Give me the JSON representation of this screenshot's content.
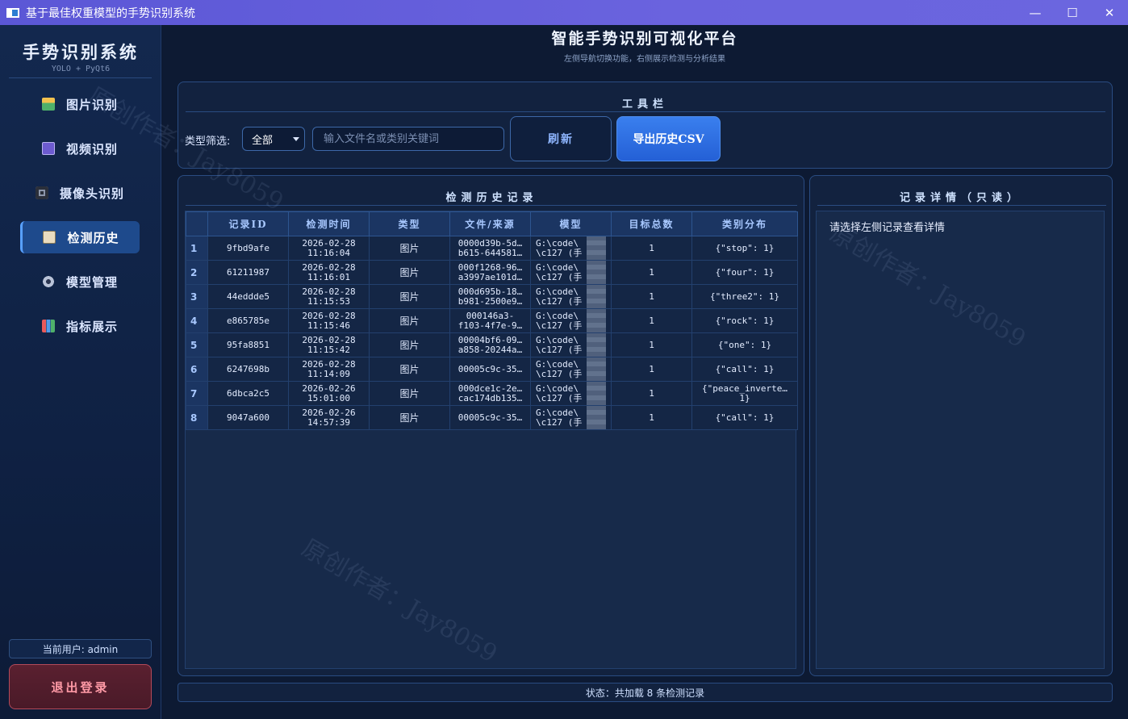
{
  "window": {
    "title": "基于最佳权重模型的手势识别系统",
    "min_icon": "minimize-icon",
    "max_icon": "maximize-icon",
    "close_icon": "close-icon"
  },
  "sidebar": {
    "brand": "手势识别系统",
    "brand_sub": "YOLO + PyQt6",
    "items": [
      {
        "label": "图片识别",
        "icon": "picture-icon",
        "active": false
      },
      {
        "label": "视频识别",
        "icon": "clapper-icon",
        "active": false
      },
      {
        "label": "摄像头识别",
        "icon": "camera-icon",
        "active": false
      },
      {
        "label": "检测历史",
        "icon": "notepad-icon",
        "active": true
      },
      {
        "label": "模型管理",
        "icon": "gear-icon",
        "active": false
      },
      {
        "label": "指标展示",
        "icon": "bar-chart-icon",
        "active": false
      }
    ],
    "current_user": "当前用户: admin",
    "logout": "退出登录"
  },
  "header": {
    "title": "智能手势识别可视化平台",
    "subtitle": "左侧导航切换功能，右侧展示检测与分析结果"
  },
  "toolbar": {
    "title": "工具栏",
    "filter_label": "类型筛选:",
    "filter_value": "全部",
    "search_placeholder": "输入文件名或类别关键词",
    "refresh": "刷新",
    "export": "导出历史CSV"
  },
  "history": {
    "title": "检测历史记录",
    "columns": [
      "记录ID",
      "检测时间",
      "类型",
      "文件/来源",
      "模型",
      "目标总数",
      "类别分布"
    ],
    "rows": [
      {
        "num": "1",
        "id": "9fbd9afe",
        "date": "2026-02-28",
        "time": "11:16:04",
        "type": "图片",
        "file1": "0000d39b-5d…",
        "file2": "b615-644581…",
        "model1": "G:\\code\\",
        "model2": "\\c127 (手",
        "count": "1",
        "dist": "{\"stop\": 1}"
      },
      {
        "num": "2",
        "id": "61211987",
        "date": "2026-02-28",
        "time": "11:16:01",
        "type": "图片",
        "file1": "000f1268-96…",
        "file2": "a3997ae101d…",
        "model1": "G:\\code\\",
        "model2": "\\c127 (手",
        "count": "1",
        "dist": "{\"four\": 1}"
      },
      {
        "num": "3",
        "id": "44eddde5",
        "date": "2026-02-28",
        "time": "11:15:53",
        "type": "图片",
        "file1": "000d695b-18…",
        "file2": "b981-2500e9…",
        "model1": "G:\\code\\",
        "model2": "\\c127 (手",
        "count": "1",
        "dist": "{\"three2\": 1}"
      },
      {
        "num": "4",
        "id": "e865785e",
        "date": "2026-02-28",
        "time": "11:15:46",
        "type": "图片",
        "file1": "000146a3-",
        "file2": "f103-4f7e-9…",
        "model1": "G:\\code\\",
        "model2": "\\c127 (手",
        "count": "1",
        "dist": "{\"rock\": 1}"
      },
      {
        "num": "5",
        "id": "95fa8851",
        "date": "2026-02-28",
        "time": "11:15:42",
        "type": "图片",
        "file1": "00004bf6-09…",
        "file2": "a858-20244a…",
        "model1": "G:\\code\\",
        "model2": "\\c127 (手",
        "count": "1",
        "dist": "{\"one\": 1}"
      },
      {
        "num": "6",
        "id": "6247698b",
        "date": "2026-02-28",
        "time": "11:14:09",
        "type": "图片",
        "file1": "00005c9c-35…",
        "file2": "",
        "model1": "G:\\code\\",
        "model2": "\\c127 (手",
        "count": "1",
        "dist": "{\"call\": 1}"
      },
      {
        "num": "7",
        "id": "6dbca2c5",
        "date": "2026-02-26",
        "time": "15:01:00",
        "type": "图片",
        "file1": "000dce1c-2e…",
        "file2": "cac174db135…",
        "model1": "G:\\code\\",
        "model2": "\\c127 (手",
        "count": "1",
        "dist": "{\"peace_inverte…",
        "dist2": "1}"
      },
      {
        "num": "8",
        "id": "9047a600",
        "date": "2026-02-26",
        "time": "14:57:39",
        "type": "图片",
        "file1": "00005c9c-35…",
        "file2": "",
        "model1": "G:\\code\\",
        "model2": "\\c127 (手",
        "count": "1",
        "dist": "{\"call\": 1}"
      }
    ]
  },
  "detail": {
    "title": "记录详情（只读）",
    "placeholder": "请选择左侧记录查看详情"
  },
  "status": {
    "text": "状态：共加载 8 条检测记录"
  },
  "watermark": "原创作者：Jay8059",
  "colors": {
    "accent": "#2f6fe0",
    "background": "#0d1a33",
    "titlebar": "#6a63de",
    "logout": "#ff9aa6"
  }
}
